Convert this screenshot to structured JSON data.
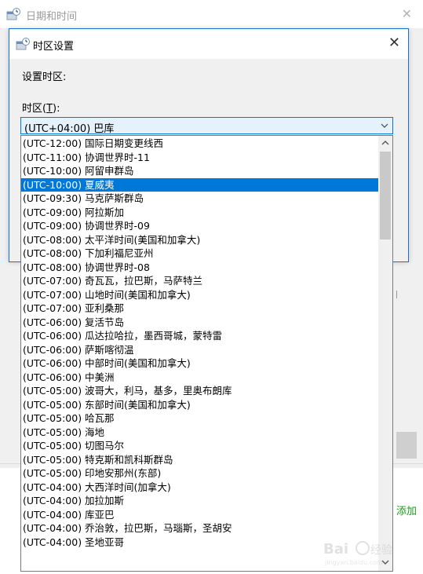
{
  "back_window": {
    "title": "日期和时间",
    "add_text": "添加"
  },
  "dialog": {
    "title": "时区设置",
    "set_label": "设置时区:",
    "timezone_label_prefix": "时区(",
    "timezone_label_key": "T",
    "timezone_label_suffix": "):"
  },
  "combo": {
    "selected": "(UTC+04:00) 巴库"
  },
  "dropdown": {
    "selected_index": 3,
    "items": [
      "(UTC-12:00) 国际日期变更线西",
      "(UTC-11:00) 协调世界时-11",
      "(UTC-10:00) 阿留申群岛",
      "(UTC-10:00) 夏威夷",
      "(UTC-09:30) 马克萨斯群岛",
      "(UTC-09:00) 阿拉斯加",
      "(UTC-09:00) 协调世界时-09",
      "(UTC-08:00) 太平洋时间(美国和加拿大)",
      "(UTC-08:00) 下加利福尼亚州",
      "(UTC-08:00) 协调世界时-08",
      "(UTC-07:00) 奇瓦瓦，拉巴斯，马萨特兰",
      "(UTC-07:00) 山地时间(美国和加拿大)",
      "(UTC-07:00) 亚利桑那",
      "(UTC-06:00) 复活节岛",
      "(UTC-06:00) 瓜达拉哈拉，墨西哥城，蒙特雷",
      "(UTC-06:00) 萨斯喀彻温",
      "(UTC-06:00) 中部时间(美国和加拿大)",
      "(UTC-06:00) 中美洲",
      "(UTC-05:00) 波哥大，利马，基多，里奥布朗库",
      "(UTC-05:00) 东部时间(美国和加拿大)",
      "(UTC-05:00) 哈瓦那",
      "(UTC-05:00) 海地",
      "(UTC-05:00) 切图马尔",
      "(UTC-05:00) 特克斯和凯科斯群岛",
      "(UTC-05:00) 印地安那州(东部)",
      "(UTC-04:00) 大西洋时间(加拿大)",
      "(UTC-04:00) 加拉加斯",
      "(UTC-04:00) 库亚巴",
      "(UTC-04:00) 乔治敦，拉巴斯，马瑙斯，圣胡安",
      "(UTC-04:00) 圣地亚哥"
    ]
  },
  "icons": {
    "window": "clock-calendar-icon",
    "close": "close-icon",
    "combo_arrow": "chevron-down-icon",
    "scroll_up": "scroll-up-arrow-icon",
    "scroll_down": "scroll-down-arrow-icon",
    "watermark": "baidu-watermark-logo"
  },
  "colors": {
    "accent": "#0078d7",
    "dialog_border": "#1a6fc6",
    "combo_bg": "#e5f1fb",
    "add_text": "#18a018"
  }
}
